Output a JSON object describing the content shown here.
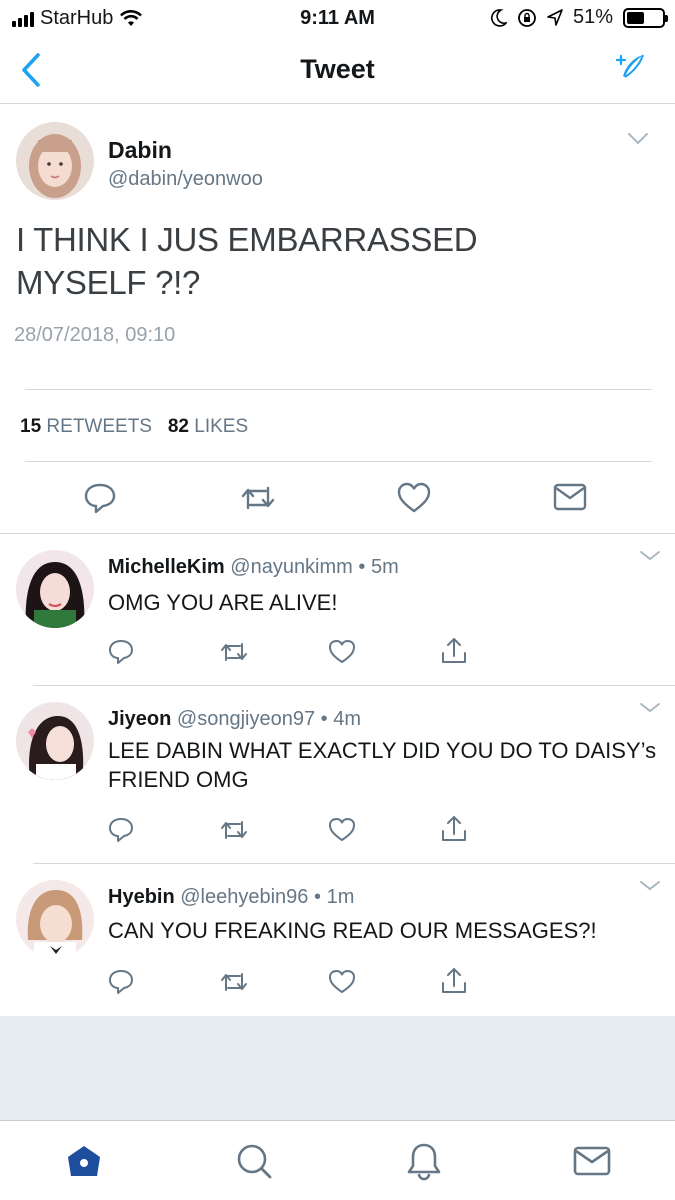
{
  "status_bar": {
    "carrier": "StarHub",
    "time": "9:11 AM",
    "battery_percent": "51%",
    "icons": [
      "signal-icon",
      "wifi-icon",
      "moon-icon",
      "rotation-lock-icon",
      "location-icon",
      "battery-icon"
    ]
  },
  "nav": {
    "title": "Tweet",
    "icons": [
      "back-icon",
      "compose-icon"
    ],
    "accent": "#1da1f2"
  },
  "tweet": {
    "name": "Dabin",
    "handle": "@dabin/yeonwoo",
    "text": "I THINK I JUS EMBARRASSED MYSELF ?!?",
    "timestamp": "28/07/2018, 09:10",
    "retweets_count": "15",
    "retweets_label": "RETWEETS",
    "likes_count": "82",
    "likes_label": "LIKES",
    "actions": [
      "reply-icon",
      "retweet-icon",
      "like-icon",
      "message-icon"
    ]
  },
  "replies": [
    {
      "name": "MichelleKim",
      "handle": "@nayunkimm",
      "time": "5m",
      "text": "OMG YOU ARE ALIVE!"
    },
    {
      "name": "Jiyeon",
      "handle": "@songjiyeon97",
      "time": "4m",
      "text": "LEE DABIN WHAT EXACTLY DID YOU DO TO DAISY’s FRIEND OMG"
    },
    {
      "name": "Hyebin",
      "handle": "@leehyebin96",
      "time": "1m",
      "text": "CAN YOU FREAKING READ OUR MESSAGES?!"
    }
  ],
  "reply_actions": [
    "reply-icon",
    "retweet-icon",
    "like-icon",
    "share-icon"
  ],
  "tab_bar": {
    "tabs": [
      "home-icon",
      "search-icon",
      "notifications-icon",
      "messages-icon"
    ],
    "active": "home-icon",
    "active_color": "#1d4e9e"
  }
}
